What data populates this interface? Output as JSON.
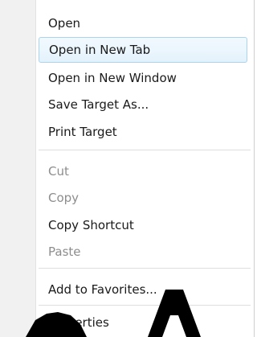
{
  "context_menu": {
    "items": [
      {
        "label": "Open",
        "state": "normal"
      },
      {
        "label": "Open in New Tab",
        "state": "highlighted"
      },
      {
        "label": "Open in New Window",
        "state": "normal"
      },
      {
        "label": "Save Target As...",
        "state": "normal"
      },
      {
        "label": "Print Target",
        "state": "normal"
      },
      {
        "label": "Cut",
        "state": "disabled"
      },
      {
        "label": "Copy",
        "state": "disabled"
      },
      {
        "label": "Copy Shortcut",
        "state": "normal"
      },
      {
        "label": "Paste",
        "state": "disabled"
      },
      {
        "label": "Add to Favorites...",
        "state": "normal"
      },
      {
        "label": "Properties",
        "state": "normal"
      }
    ],
    "colors": {
      "highlight_border": "#a9d3ef",
      "highlight_fill": "#e4f2fc",
      "disabled_text": "#8d8d8d",
      "watermark": "#000000"
    }
  }
}
